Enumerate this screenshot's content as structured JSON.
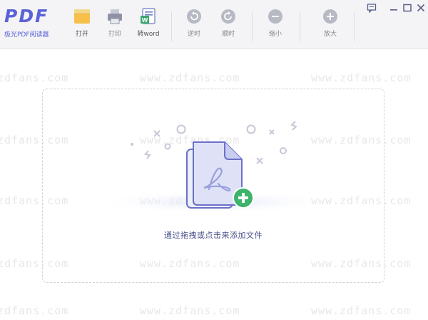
{
  "app": {
    "logo_text": "PDF",
    "logo_subtitle": "极光PDF阅读器",
    "accent": "#5a62d8"
  },
  "toolbar": {
    "buttons": [
      {
        "label": "打开",
        "icon": "folder-icon"
      },
      {
        "label": "打印",
        "icon": "printer-icon"
      },
      {
        "label": "转word",
        "icon": "word-convert-icon"
      },
      {
        "label": "逆时",
        "icon": "rotate-ccw-icon"
      },
      {
        "label": "顺时",
        "icon": "rotate-cw-icon"
      },
      {
        "label": "缩小",
        "icon": "zoom-out-icon"
      },
      {
        "label": "放大",
        "icon": "zoom-in-icon"
      }
    ]
  },
  "window_controls": [
    "feedback-icon",
    "minimize-icon",
    "maximize-icon",
    "close-icon"
  ],
  "main": {
    "drop_hint": "通过拖拽或点击来添加文件",
    "add_badge_color": "#3db36b"
  },
  "watermark": {
    "text": "www.zdfans.com",
    "text_short": "zdfans.com"
  }
}
